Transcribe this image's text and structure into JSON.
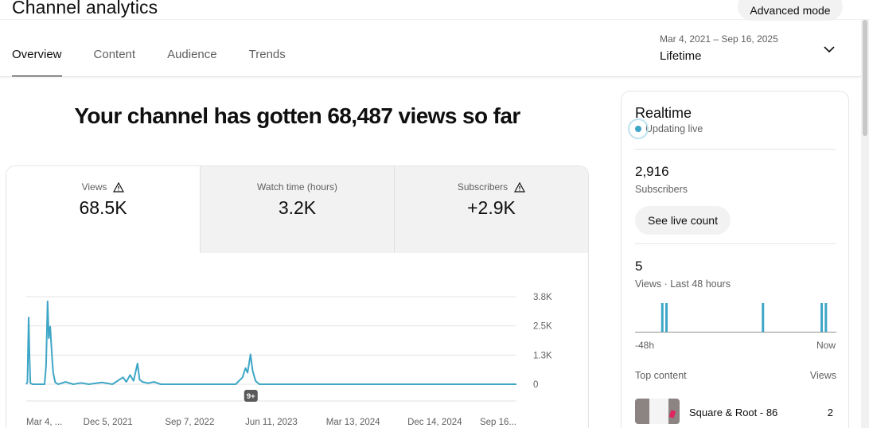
{
  "page": {
    "title": "Channel analytics",
    "advanced_mode": "Advanced mode"
  },
  "tabs": [
    {
      "label": "Overview",
      "active": true
    },
    {
      "label": "Content",
      "active": false
    },
    {
      "label": "Audience",
      "active": false
    },
    {
      "label": "Trends",
      "active": false
    }
  ],
  "date_range": {
    "dates": "Mar 4, 2021 – Sep 16, 2025",
    "period": "Lifetime",
    "icon": "chevron-down-icon"
  },
  "headline": "Your channel has gotten 68,487 views so far",
  "metrics": [
    {
      "label": "Views",
      "value": "68.5K",
      "warning": true,
      "selected": true
    },
    {
      "label": "Watch time (hours)",
      "value": "3.2K",
      "warning": false,
      "selected": false
    },
    {
      "label": "Subscribers",
      "value": "+2.9K",
      "warning": true,
      "selected": false
    }
  ],
  "chart_data": {
    "type": "line",
    "title": "",
    "xlabel": "",
    "ylabel": "",
    "y_ticks": [
      "3.8K",
      "2.5K",
      "1.3K",
      "0"
    ],
    "ylim": [
      0,
      3800
    ],
    "x_ticks": [
      "Mar 4, ...",
      "Dec 5, 2021",
      "Sep 7, 2022",
      "Jun 11, 2023",
      "Mar 13, 2024",
      "Dec 14, 2024",
      "Sep 16..."
    ],
    "annotation": "9+",
    "color": "#3ea6c6",
    "series": [
      {
        "name": "",
        "points": [
          [
            "2021-03-04",
            0
          ],
          [
            "2021-03-08",
            100
          ],
          [
            "2021-03-12",
            2900
          ],
          [
            "2021-03-15",
            1200
          ],
          [
            "2021-03-18",
            50
          ],
          [
            "2021-03-25",
            0
          ],
          [
            "2021-05-05",
            0
          ],
          [
            "2021-05-10",
            800
          ],
          [
            "2021-05-15",
            3600
          ],
          [
            "2021-05-19",
            2000
          ],
          [
            "2021-05-24",
            2500
          ],
          [
            "2021-05-29",
            1400
          ],
          [
            "2021-06-03",
            500
          ],
          [
            "2021-06-10",
            80
          ],
          [
            "2021-06-20",
            0
          ],
          [
            "2021-07-15",
            100
          ],
          [
            "2021-08-10",
            0
          ],
          [
            "2021-09-05",
            60
          ],
          [
            "2021-10-01",
            0
          ],
          [
            "2021-11-15",
            80
          ],
          [
            "2021-12-20",
            0
          ],
          [
            "2022-01-25",
            300
          ],
          [
            "2022-02-05",
            100
          ],
          [
            "2022-02-18",
            400
          ],
          [
            "2022-03-02",
            150
          ],
          [
            "2022-03-15",
            900
          ],
          [
            "2022-03-22",
            200
          ],
          [
            "2022-04-01",
            100
          ],
          [
            "2022-04-20",
            50
          ],
          [
            "2022-05-10",
            100
          ],
          [
            "2022-06-01",
            0
          ],
          [
            "2023-02-10",
            0
          ],
          [
            "2023-03-05",
            300
          ],
          [
            "2023-03-15",
            700
          ],
          [
            "2023-03-22",
            500
          ],
          [
            "2023-04-01",
            1300
          ],
          [
            "2023-04-08",
            600
          ],
          [
            "2023-04-18",
            150
          ],
          [
            "2023-05-01",
            0
          ],
          [
            "2025-09-16",
            0
          ]
        ]
      }
    ]
  },
  "realtime": {
    "title": "Realtime",
    "status": "Updating live",
    "subscribers_value": "2,916",
    "subscribers_label": "Subscribers",
    "live_count_button": "See live count",
    "views_value": "5",
    "views_label": "Views · Last 48 hours",
    "axis_start": "-48h",
    "axis_end": "Now",
    "bars_color": "#3ea6c6",
    "bars_hours_ago": [
      41.5,
      40.5,
      17.5,
      3.5,
      2.5
    ],
    "top_content_label": "Top content",
    "views_col_label": "Views",
    "top_content": [
      {
        "title": "Square & Root - 86",
        "views": "2"
      }
    ]
  }
}
